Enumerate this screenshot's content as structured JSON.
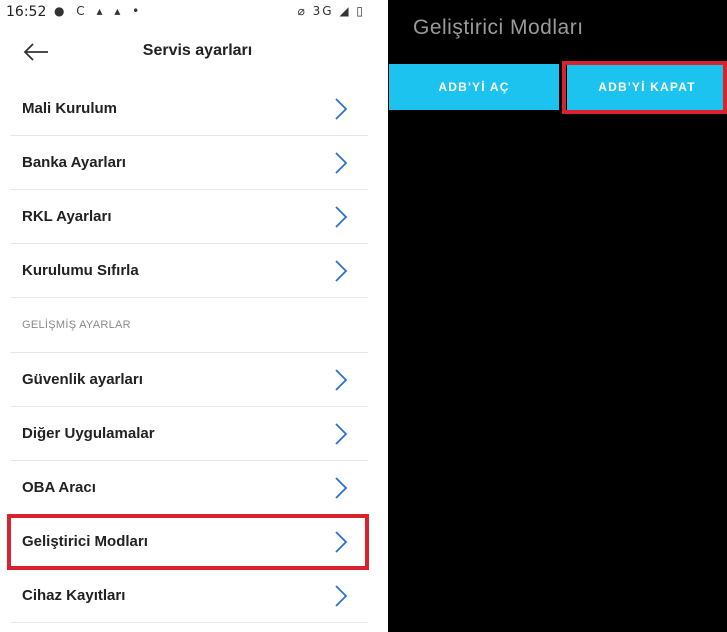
{
  "status_bar": {
    "time": "16:52",
    "left_icons": "● C ▴ ▴ •",
    "right_icons": "⌀ 3G ◢ ▯"
  },
  "header": {
    "title": "Servis ayarları",
    "back_icon": "arrow-left-icon"
  },
  "menu": {
    "items": [
      {
        "label": "Mali Kurulum"
      },
      {
        "label": "Banka Ayarları"
      },
      {
        "label": "RKL Ayarları"
      },
      {
        "label": "Kurulumu Sıfırla"
      }
    ],
    "section_header": "GELİŞMİŞ AYARLAR",
    "advanced_items": [
      {
        "label": "Güvenlik ayarları"
      },
      {
        "label": "Diğer Uygulamalar"
      },
      {
        "label": "OBA Aracı"
      },
      {
        "label": "Geliştirici Modları"
      },
      {
        "label": "Cihaz Kayıtları"
      }
    ]
  },
  "dev_panel": {
    "title": "Geliştirici Modları",
    "open_adb_label": "ADB'Yİ AÇ",
    "close_adb_label": "ADB'Yİ KAPAT"
  },
  "colors": {
    "accent": "#1cc3ee",
    "highlight": "#d8232f",
    "chevron": "#2a6fd8"
  }
}
